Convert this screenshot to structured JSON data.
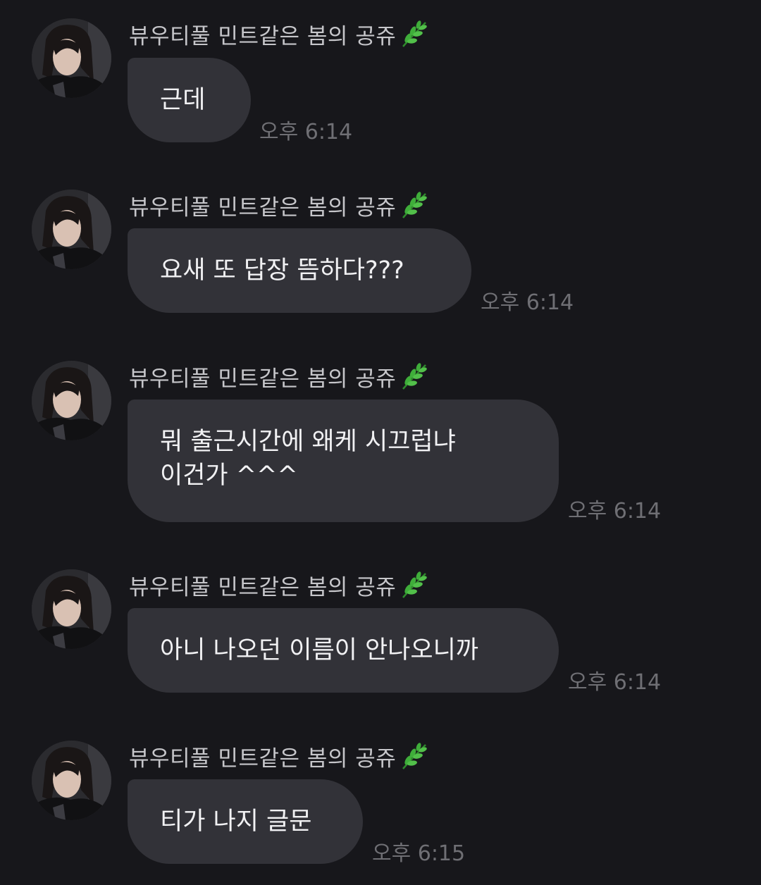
{
  "sender_name": "뷰우티풀 민트같은 봄의 공쥬",
  "sender_icon": "leaf-emoji-icon",
  "messages": [
    {
      "text": "근데",
      "time": "오후 6:14"
    },
    {
      "text": "요새 또 답장 뜸하다???",
      "time": "오후 6:14"
    },
    {
      "text": "뭐 출근시간에 왜케 시끄럽냐\n이건가 ^^^",
      "time": "오후 6:14"
    },
    {
      "text": "아니 나오던 이름이 안나오니까",
      "time": "오후 6:14"
    },
    {
      "text": "티가 나지 글문",
      "time": "오후 6:15"
    }
  ],
  "colors": {
    "background": "#17171b",
    "bubble": "#323238",
    "bubble_text": "#f1f1f3",
    "sender_text": "#c6c6ca",
    "time_text": "#6f6f74",
    "leaf": "#3fae3a"
  }
}
